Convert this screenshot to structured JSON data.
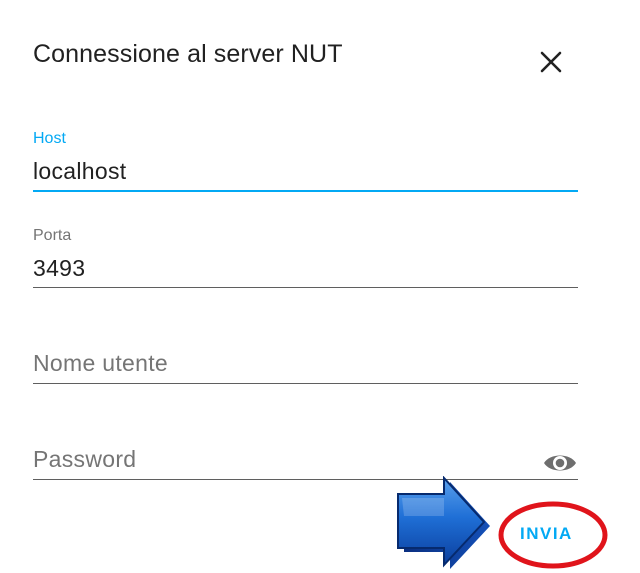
{
  "dialog": {
    "title": "Connessione al server NUT",
    "close_icon": "close-icon"
  },
  "fields": {
    "host": {
      "label": "Host",
      "value": "localhost"
    },
    "port": {
      "label": "Porta",
      "value": "3493"
    },
    "username": {
      "placeholder": "Nome utente"
    },
    "password": {
      "placeholder": "Password",
      "toggle_icon": "eye-icon"
    }
  },
  "actions": {
    "submit_label": "INVIA"
  },
  "annotations": {
    "arrow_icon": "arrow-right-icon",
    "highlight": "red-circle"
  },
  "colors": {
    "accent": "#03a9f4",
    "annotation_red": "#e0141b",
    "annotation_blue": "#1565c0"
  }
}
